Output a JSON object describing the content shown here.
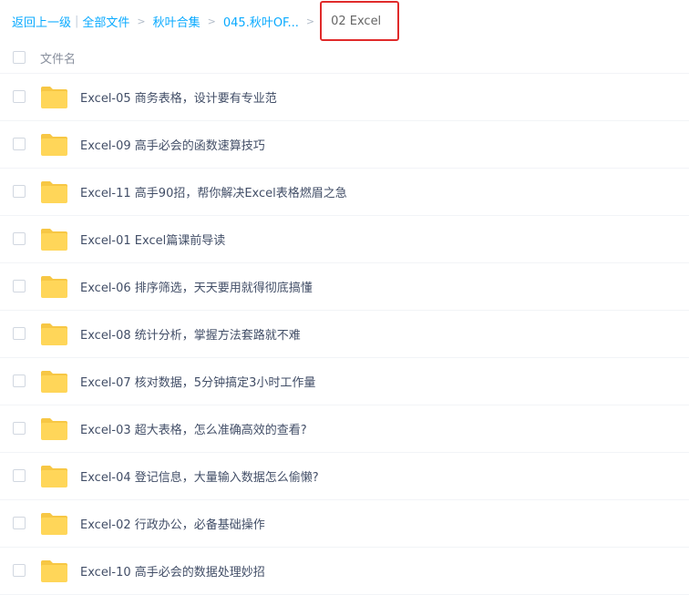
{
  "breadcrumb": {
    "back": "返回上一级",
    "sep": "|",
    "all_files": "全部文件",
    "crumbs": [
      "秋叶合集",
      "045.秋叶OF..."
    ],
    "arrow": ">",
    "current": "02 Excel"
  },
  "header": {
    "column_name": "文件名"
  },
  "colors": {
    "folder": "#ffd659",
    "folder_tab": "#f7c744",
    "link": "#09aaff",
    "highlight_border": "#e02a2a"
  },
  "files": [
    {
      "name": "Excel-05 商务表格，设计要有专业范",
      "icon": "folder-icon"
    },
    {
      "name": "Excel-09 高手必会的函数速算技巧",
      "icon": "folder-icon"
    },
    {
      "name": "Excel-11 高手90招，帮你解决Excel表格燃眉之急",
      "icon": "folder-icon"
    },
    {
      "name": "Excel-01 Excel篇课前导读",
      "icon": "folder-icon"
    },
    {
      "name": "Excel-06 排序筛选，天天要用就得彻底搞懂",
      "icon": "folder-icon"
    },
    {
      "name": "Excel-08 统计分析，掌握方法套路就不难",
      "icon": "folder-icon"
    },
    {
      "name": "Excel-07 核对数据，5分钟搞定3小时工作量",
      "icon": "folder-icon"
    },
    {
      "name": "Excel-03 超大表格，怎么准确高效的查看?",
      "icon": "folder-icon"
    },
    {
      "name": "Excel-04 登记信息，大量输入数据怎么偷懒?",
      "icon": "folder-icon"
    },
    {
      "name": "Excel-02 行政办公，必备基础操作",
      "icon": "folder-icon"
    },
    {
      "name": "Excel-10 高手必会的数据处理妙招",
      "icon": "folder-icon"
    }
  ]
}
